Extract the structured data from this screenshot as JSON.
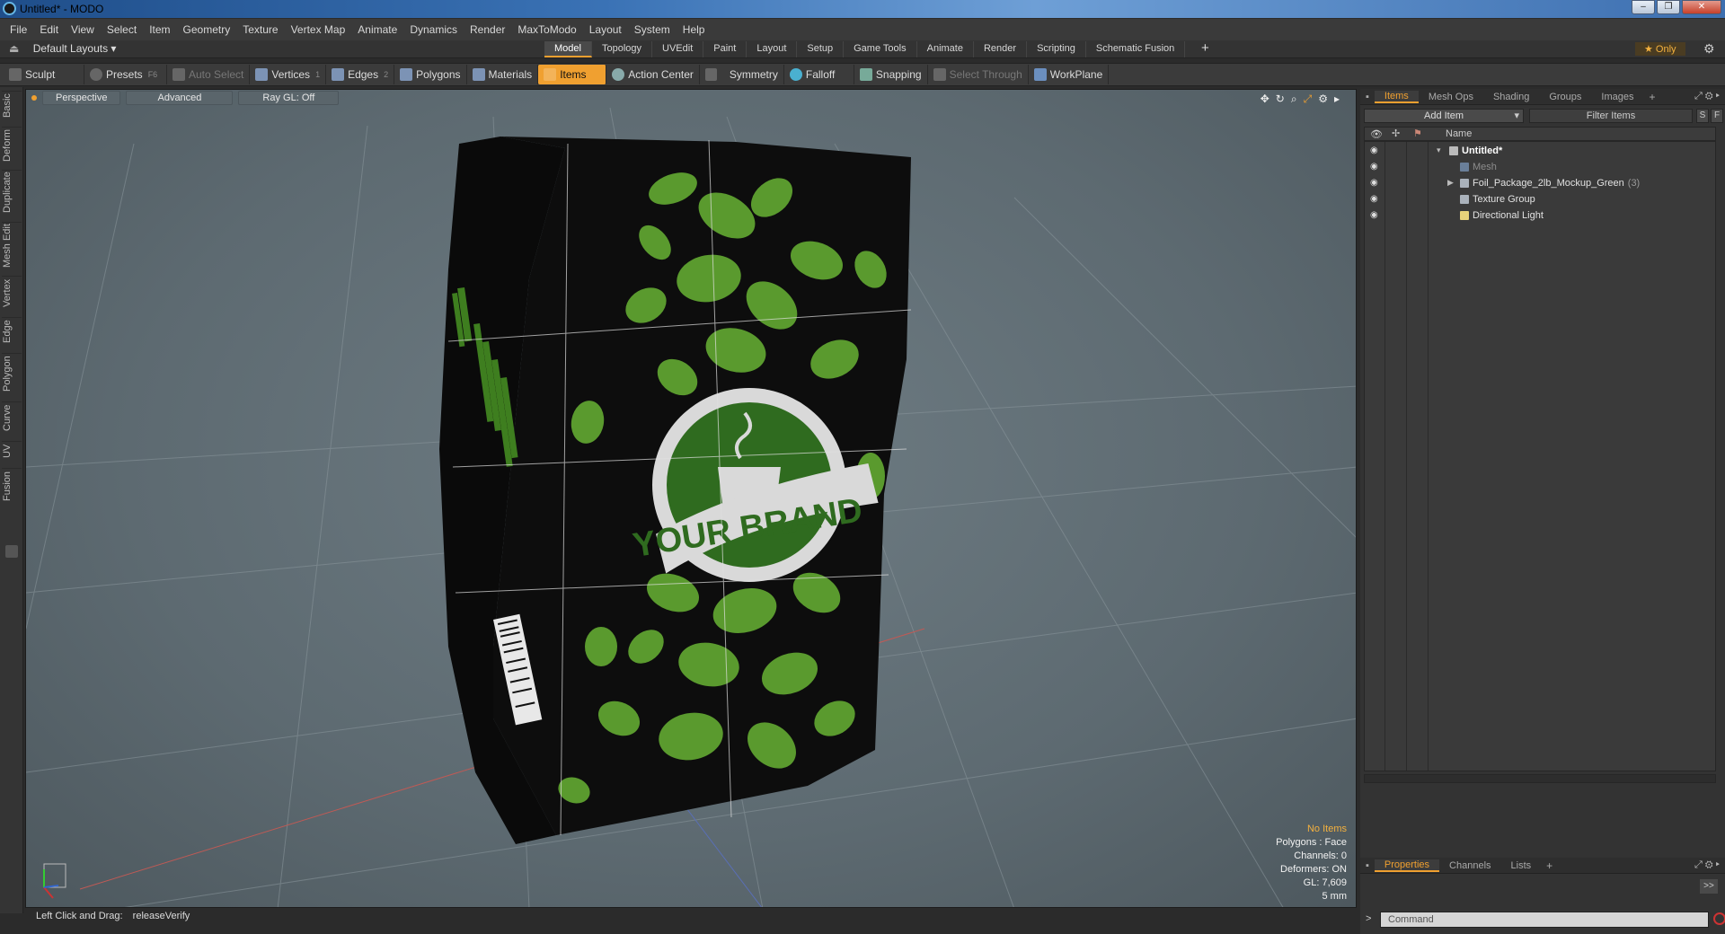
{
  "window": {
    "title": "Untitled* - MODO",
    "buttons": [
      "–",
      "❐",
      "✕"
    ]
  },
  "menu": [
    "File",
    "Edit",
    "View",
    "Select",
    "Item",
    "Geometry",
    "Texture",
    "Vertex Map",
    "Animate",
    "Dynamics",
    "Render",
    "MaxToModo",
    "Layout",
    "System",
    "Help"
  ],
  "layouts": {
    "label": "Default Layouts ▾"
  },
  "tabs": [
    {
      "label": "Model",
      "active": true
    },
    {
      "label": "Topology"
    },
    {
      "label": "UVEdit"
    },
    {
      "label": "Paint"
    },
    {
      "label": "Layout"
    },
    {
      "label": "Setup"
    },
    {
      "label": "Game Tools"
    },
    {
      "label": "Animate"
    },
    {
      "label": "Render"
    },
    {
      "label": "Scripting"
    },
    {
      "label": "Schematic Fusion"
    }
  ],
  "tab_plus": "+",
  "only_button": "★ Only",
  "toolbar": [
    {
      "label": "Sculpt",
      "icon": "sculpt-icon"
    },
    {
      "label": "Presets",
      "key": "F6",
      "icon": "presets-icon"
    },
    {
      "label": "Auto Select",
      "dim": true,
      "icon": "auto-select-icon"
    },
    {
      "label": "Vertices",
      "key": "1",
      "icon": "vertices-icon"
    },
    {
      "label": "Edges",
      "key": "2",
      "icon": "edges-icon"
    },
    {
      "label": "Polygons",
      "icon": "polygons-icon"
    },
    {
      "label": "Materials",
      "icon": "materials-icon"
    },
    {
      "label": "Items",
      "active": true,
      "icon": "items-icon"
    },
    {
      "label": "Action Center",
      "icon": "action-center-icon"
    },
    {
      "label": "Symmetry",
      "icon": "symmetry-icon"
    },
    {
      "label": "Falloff",
      "icon": "falloff-icon"
    },
    {
      "label": "Snapping",
      "icon": "snapping-icon"
    },
    {
      "label": "Select Through",
      "dim": true,
      "icon": "select-through-icon"
    },
    {
      "label": "WorkPlane",
      "icon": "workplane-icon"
    }
  ],
  "left_tabs": [
    "Basic",
    "Deform",
    "Duplicate",
    "Mesh Edit",
    "Vertex",
    "Edge",
    "Polygon",
    "Curve",
    "UV",
    "Fusion"
  ],
  "viewport": {
    "buttons": [
      "Perspective",
      "Advanced",
      "Ray GL: Off"
    ],
    "stats": {
      "selection": "No Items",
      "polygons": "Polygons : Face",
      "channels": "Channels: 0",
      "deformers": "Deformers: ON",
      "gl": "GL: 7,609",
      "units": "5 mm"
    },
    "package_text": "YOUR BRAND"
  },
  "status": {
    "hint": "Left Click and Drag:",
    "action": "releaseVerify"
  },
  "items_panel": {
    "tabs": [
      "Items",
      "Mesh Ops",
      "Shading",
      "Groups",
      "Images"
    ],
    "add_item": "Add Item",
    "filter": "Filter Items",
    "s_btn": "S",
    "f_btn": "F",
    "column": "Name",
    "tree": [
      {
        "label": "Untitled*",
        "level": 0,
        "bold": true
      },
      {
        "label": "Mesh",
        "level": 1,
        "dim": true
      },
      {
        "label": "Foil_Package_2lb_Mockup_Green",
        "count": "(3)",
        "level": 1,
        "expandable": true
      },
      {
        "label": "Texture Group",
        "level": 1
      },
      {
        "label": "Directional Light",
        "level": 1
      }
    ]
  },
  "props_panel": {
    "tabs": [
      "Properties",
      "Channels",
      "Lists"
    ],
    "expand": ">>"
  },
  "command": {
    "prompt": ">",
    "placeholder": "Command"
  },
  "colors": {
    "accent": "#f0a030",
    "viewport_bg": "#64727a",
    "package": "#0b0b0b",
    "leaf": "#5a9a2e"
  }
}
